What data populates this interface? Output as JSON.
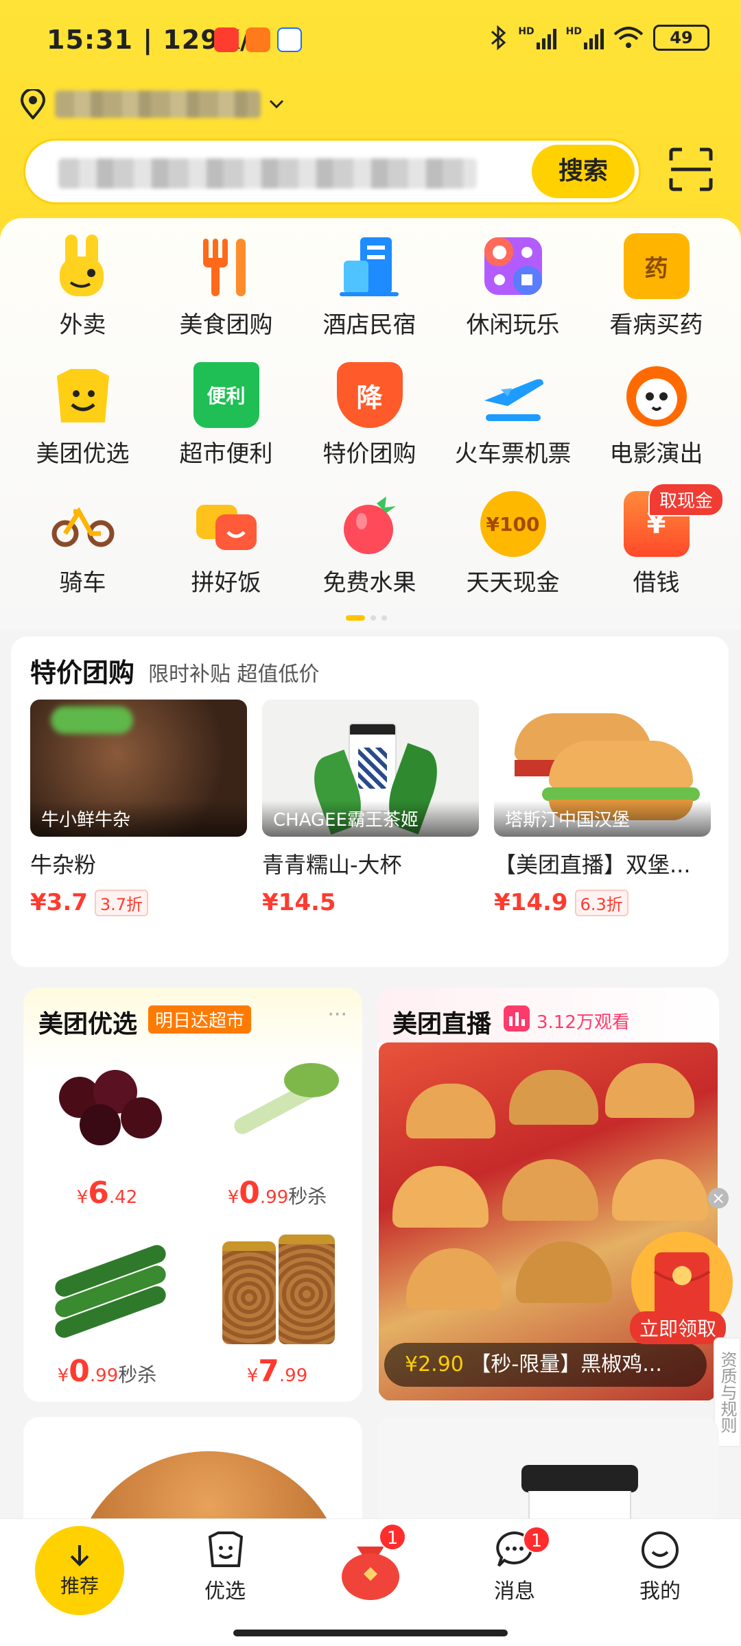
{
  "status_bar": {
    "time": "15:31",
    "net_speed": "129K/s",
    "battery": "49",
    "signal_labels": [
      "HD",
      "HD"
    ]
  },
  "search": {
    "button_label": "搜索"
  },
  "categories": [
    {
      "label": "外卖",
      "icon": "waimai-rabbit-icon",
      "color": "#ffd21f"
    },
    {
      "label": "美食团购",
      "icon": "fork-icon",
      "color": "#ff6a1a"
    },
    {
      "label": "酒店民宿",
      "icon": "hotel-building-icon",
      "color": "#1e8bff"
    },
    {
      "label": "休闲玩乐",
      "icon": "leisure-grid-icon",
      "color": "#b25cff"
    },
    {
      "label": "看病买药",
      "icon": "medicine-box-icon",
      "color": "#ffb400",
      "icon_text": "药"
    },
    {
      "label": "美团优选",
      "icon": "youxuan-bag-icon",
      "color": "#ffcf16"
    },
    {
      "label": "超市便利",
      "icon": "supermarket-basket-icon",
      "color": "#1fbf55",
      "icon_text": "便利"
    },
    {
      "label": "特价团购",
      "icon": "discount-arrow-icon",
      "color": "#ff5a2a",
      "icon_text": "降"
    },
    {
      "label": "火车票机票",
      "icon": "plane-icon",
      "color": "#1e9bff"
    },
    {
      "label": "电影演出",
      "icon": "cat-face-icon",
      "color": "#ff6a00"
    },
    {
      "label": "骑车",
      "icon": "bicycle-icon",
      "color": "#ffb400"
    },
    {
      "label": "拼好饭",
      "icon": "pinhaofan-icon",
      "color": "#ffc21a"
    },
    {
      "label": "免费水果",
      "icon": "strawberry-icon",
      "color": "#ff4a5a"
    },
    {
      "label": "天天现金",
      "icon": "cash-coin-icon",
      "color": "#ffb800",
      "icon_text": "¥100"
    },
    {
      "label": "借钱",
      "icon": "loan-wallet-icon",
      "color": "#ff4a2a",
      "icon_text": "¥",
      "tag": "取现金"
    }
  ],
  "deals": {
    "title": "特价团购",
    "subtitle": "限时补贴 超值低价",
    "items": [
      {
        "shop": "牛小鲜牛杂",
        "name": "牛杂粉",
        "price": "¥3.7",
        "discount": "3.7折"
      },
      {
        "shop": "CHAGEE霸王茶姬",
        "name": "青青糯山-大杯",
        "price": "¥14.5",
        "discount": ""
      },
      {
        "shop": "塔斯汀中国汉堡",
        "name": "【美团直播】双堡...",
        "price": "¥14.9",
        "discount": "6.3折"
      }
    ]
  },
  "youxuan": {
    "title": "美团优选",
    "badge": "明日达超市",
    "more": "···",
    "items": [
      {
        "currency": "¥",
        "int": "6",
        "dec": ".42",
        "suffix": ""
      },
      {
        "currency": "¥",
        "int": "0",
        "dec": ".99",
        "suffix": "秒杀"
      },
      {
        "currency": "¥",
        "int": "0",
        "dec": ".99",
        "suffix": "秒杀"
      },
      {
        "currency": "¥",
        "int": "7",
        "dec": ".99",
        "suffix": ""
      }
    ]
  },
  "zhibo": {
    "title": "美团直播",
    "views": "3.12万观看",
    "price": "¥2.90",
    "caption": "【秒-限量】黑椒鸡..."
  },
  "floating": {
    "redpacket_label": "立即领取",
    "close": "×",
    "rules": "资质与规则"
  },
  "bottom_nav": [
    {
      "label": "推荐"
    },
    {
      "label": "优选"
    },
    {
      "label": "",
      "badge": "1"
    },
    {
      "label": "消息",
      "badge": "1"
    },
    {
      "label": "我的"
    }
  ]
}
